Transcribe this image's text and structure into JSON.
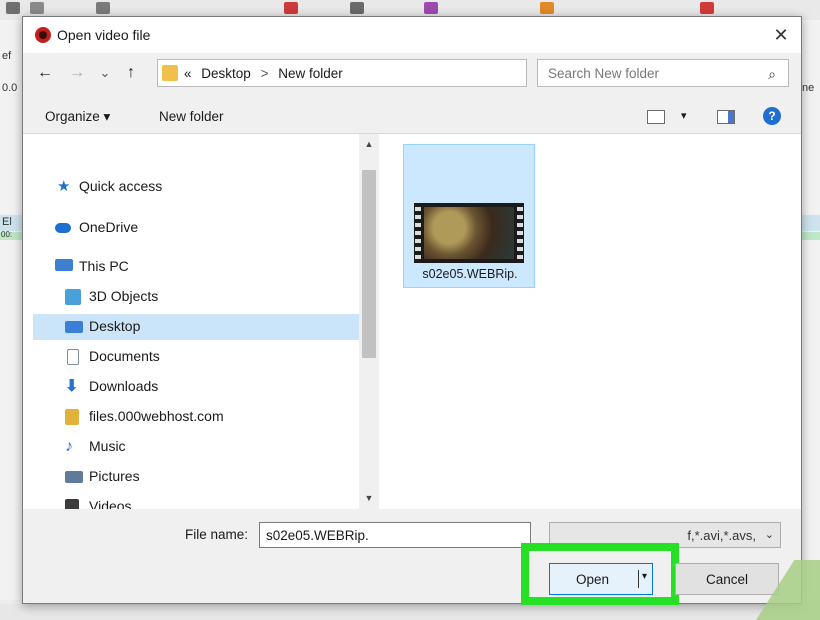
{
  "background_app": {
    "left_text_1": "ef",
    "left_text_2": "0.0",
    "left_text_3": "El",
    "left_text_4": "00:",
    "right_text": "ne"
  },
  "dialog": {
    "title": "Open video file",
    "close": "✕",
    "nav": {
      "back": "←",
      "forward": "→",
      "recent": "⌄",
      "up": "↑"
    },
    "address": {
      "crumbs": [
        "«",
        "Desktop",
        ">",
        "New folder"
      ],
      "dropdown": "⌄",
      "refresh": "↻"
    },
    "search": {
      "placeholder": "Search New folder",
      "icon": "⌕"
    },
    "command_bar": {
      "organize_label": "Organize ▾",
      "new_folder_label": "New folder",
      "view_dropdown": "▾",
      "help": "?"
    },
    "nav_pane": {
      "items": [
        {
          "label": "Quick access",
          "icon": "star-icon",
          "color": "#1f6fd1"
        },
        {
          "label": "OneDrive",
          "icon": "cloud-icon",
          "color": "#1f6fd1"
        },
        {
          "label": "This PC",
          "icon": "computer-icon",
          "color": "#3d7fd0"
        },
        {
          "label": "3D Objects",
          "icon": "cube-icon",
          "color": "#4aa0d8"
        },
        {
          "label": "Desktop",
          "icon": "desktop-icon",
          "color": "#3c7fd6"
        },
        {
          "label": "Documents",
          "icon": "document-icon",
          "color": "#7d8ea3"
        },
        {
          "label": "Downloads",
          "icon": "download-icon",
          "color": "#2a72c9"
        },
        {
          "label": "files.000webhost.com",
          "icon": "network-folder-icon",
          "color": "#e0b23a"
        },
        {
          "label": "Music",
          "icon": "music-icon",
          "color": "#2a72c9"
        },
        {
          "label": "Pictures",
          "icon": "pictures-icon",
          "color": "#5f7b9a"
        },
        {
          "label": "Videos",
          "icon": "videos-icon",
          "color": "#3b3b3b"
        }
      ],
      "selected": "Desktop",
      "scroll_up": "▲",
      "scroll_down": "▼"
    },
    "files": [
      {
        "name": "s02e05.WEBRip."
      }
    ],
    "footer": {
      "file_name_label": "File name:",
      "file_name_value": "s02e05.WEBRip.",
      "file_name_dropdown": "⌄",
      "file_type_value": "f,*.avi,*.avs,",
      "file_type_dropdown": "⌄",
      "open_label": "Open",
      "open_arrow": "▾",
      "cancel_label": "Cancel"
    },
    "highlight_color": "#25e025"
  }
}
